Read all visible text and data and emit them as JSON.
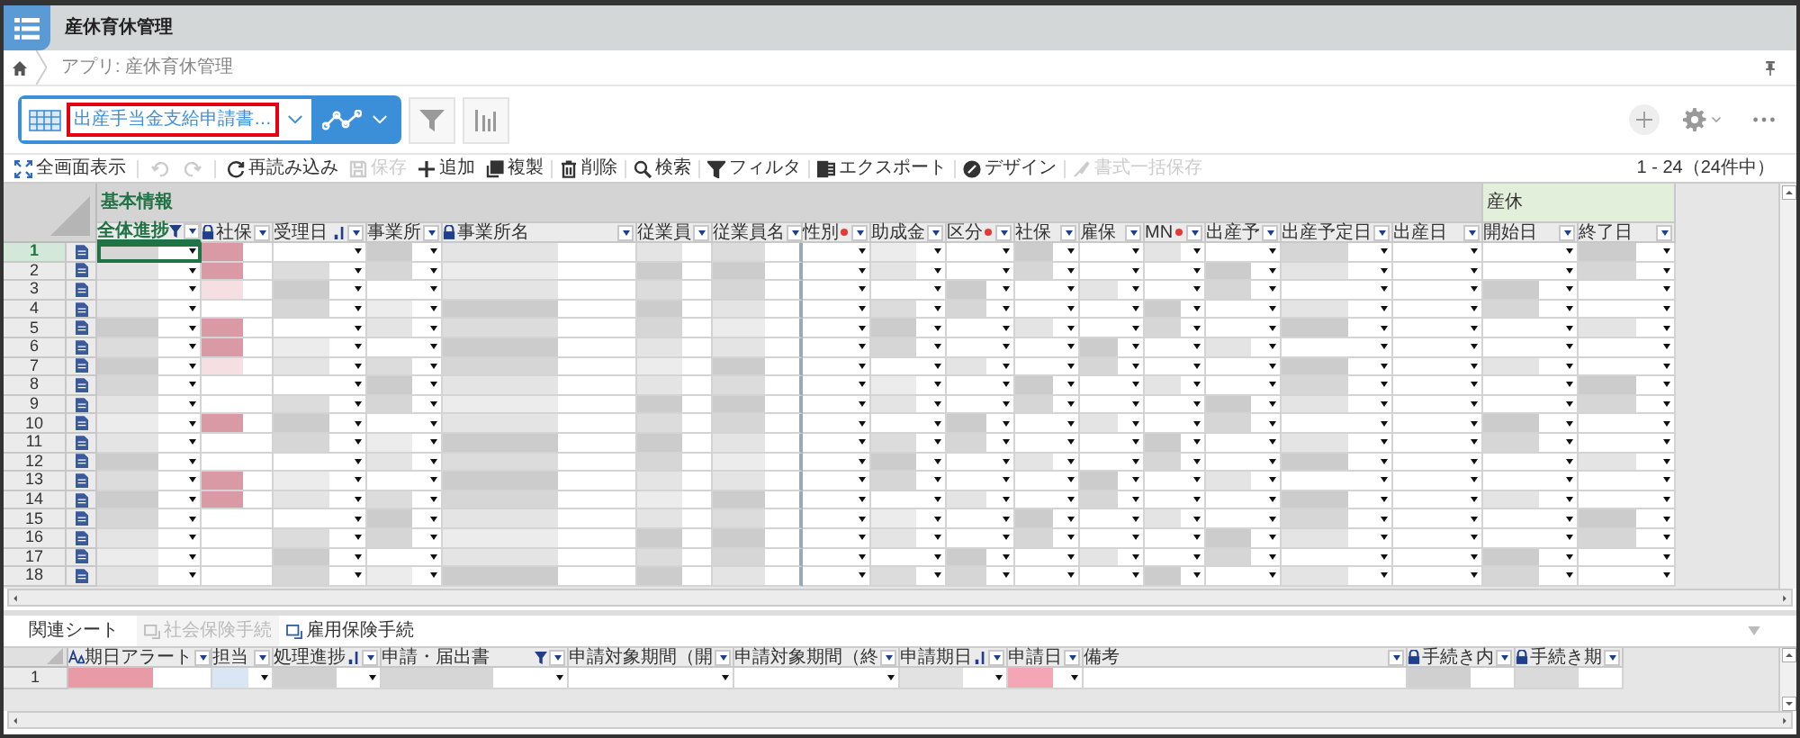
{
  "app": {
    "title": "産休育休管理"
  },
  "breadcrumb": {
    "text": "アプリ: 産休育休管理"
  },
  "view_selector": {
    "view_name": "出産手当金支給申請書…"
  },
  "history_buttons": [
    {
      "disabled": true
    },
    {
      "disabled": true
    }
  ],
  "toolbar": [
    {
      "label": "全画面表示",
      "disabled": false
    },
    {
      "label": "再読み込み",
      "disabled": false
    },
    {
      "label": "保存",
      "disabled": true
    },
    {
      "label": "追加",
      "disabled": false
    },
    {
      "label": "複製",
      "disabled": false
    },
    {
      "label": "削除",
      "disabled": false
    },
    {
      "label": "検索",
      "disabled": false
    },
    {
      "label": "フィルタ",
      "disabled": false
    },
    {
      "label": "エクスポート",
      "disabled": false
    },
    {
      "label": "デザイン",
      "disabled": false
    },
    {
      "label": "書式一括保存",
      "disabled": true
    }
  ],
  "record_count": "1 - 24（24件中）",
  "grid": {
    "groups": [
      {
        "label": "基本情報",
        "color": "#d4d4d4",
        "selected": true,
        "columns": [
          {
            "label": "全体進捗",
            "kind": "filter",
            "locked": false,
            "required": false,
            "dropdown": true,
            "selected": true
          },
          {
            "label": "社保",
            "kind": "plain",
            "locked": true,
            "required": false,
            "dropdown": false,
            "selected": false
          },
          {
            "label": "受理日",
            "kind": "sort",
            "locked": false,
            "required": false,
            "dropdown": true,
            "selected": false
          },
          {
            "label": "事業所",
            "kind": "plain",
            "locked": false,
            "required": false,
            "dropdown": true,
            "selected": false
          },
          {
            "label": "事業所名",
            "kind": "plain",
            "locked": true,
            "required": false,
            "dropdown": false,
            "selected": false
          },
          {
            "label": "従業員",
            "kind": "plain",
            "locked": false,
            "required": false,
            "dropdown": false,
            "selected": false
          },
          {
            "label": "従業員名",
            "kind": "plain",
            "locked": false,
            "required": false,
            "dropdown": false,
            "selected": false
          },
          {
            "label": "性別",
            "kind": "plain",
            "locked": false,
            "required": true,
            "dropdown": true,
            "selected": false
          },
          {
            "label": "助成金",
            "kind": "plain",
            "locked": false,
            "required": false,
            "dropdown": true,
            "selected": false
          },
          {
            "label": "区分",
            "kind": "plain",
            "locked": false,
            "required": true,
            "dropdown": true,
            "selected": false
          },
          {
            "label": "社保",
            "kind": "plain",
            "locked": false,
            "required": false,
            "dropdown": true,
            "selected": false
          },
          {
            "label": "雇保",
            "kind": "plain",
            "locked": false,
            "required": false,
            "dropdown": true,
            "selected": false
          },
          {
            "label": "MN",
            "kind": "plain",
            "locked": false,
            "required": true,
            "dropdown": true,
            "selected": false
          },
          {
            "label": "出産予",
            "kind": "plain",
            "locked": false,
            "required": false,
            "dropdown": true,
            "selected": false
          },
          {
            "label": "出産予定日",
            "kind": "plain",
            "locked": false,
            "required": false,
            "dropdown": true,
            "selected": false
          },
          {
            "label": "出産日",
            "kind": "plain",
            "locked": false,
            "required": false,
            "dropdown": true,
            "selected": false
          }
        ]
      },
      {
        "label": "産休",
        "color": "#e2efda",
        "selected": false,
        "columns": [
          {
            "label": "開始日",
            "kind": "plain",
            "locked": false,
            "required": false,
            "dropdown": true,
            "selected": false
          },
          {
            "label": "終了日",
            "kind": "plain",
            "locked": false,
            "required": false,
            "dropdown": true,
            "selected": false
          }
        ]
      }
    ],
    "rows": [
      {
        "number": "1",
        "selected": true
      },
      {
        "number": "2",
        "selected": false
      },
      {
        "number": "3",
        "selected": false
      },
      {
        "number": "4",
        "selected": false
      },
      {
        "number": "5",
        "selected": false
      },
      {
        "number": "6",
        "selected": false
      },
      {
        "number": "7",
        "selected": false
      },
      {
        "number": "8",
        "selected": false
      },
      {
        "number": "9",
        "selected": false
      },
      {
        "number": "10",
        "selected": false
      },
      {
        "number": "11",
        "selected": false
      },
      {
        "number": "12",
        "selected": false
      },
      {
        "number": "13",
        "selected": false
      },
      {
        "number": "14",
        "selected": false
      },
      {
        "number": "15",
        "selected": false
      },
      {
        "number": "16",
        "selected": false
      },
      {
        "number": "17",
        "selected": false
      },
      {
        "number": "18",
        "selected": false
      }
    ]
  },
  "related": {
    "title": "関連シート",
    "tabs": [
      {
        "label": "社会保険手続",
        "selected": false
      },
      {
        "label": "雇用保険手続",
        "selected": true
      }
    ],
    "columns": [
      {
        "label": "期日アラート",
        "kind": "alert",
        "locked": false,
        "required": false,
        "dropdown": false
      },
      {
        "label": "担当",
        "kind": "plain",
        "locked": false,
        "required": false,
        "dropdown": true
      },
      {
        "label": "処理進捗",
        "kind": "sort",
        "locked": false,
        "required": false,
        "dropdown": true
      },
      {
        "label": "申請・届出書",
        "kind": "filter",
        "locked": false,
        "required": false,
        "dropdown": true
      },
      {
        "label": "申請対象期間（開",
        "kind": "plain",
        "locked": false,
        "required": false,
        "dropdown": true
      },
      {
        "label": "申請対象期間（終",
        "kind": "plain",
        "locked": false,
        "required": false,
        "dropdown": true
      },
      {
        "label": "申請期日",
        "kind": "sort",
        "locked": false,
        "required": false,
        "dropdown": true
      },
      {
        "label": "申請日",
        "kind": "plain",
        "locked": false,
        "required": false,
        "dropdown": true
      },
      {
        "label": "備考",
        "kind": "plain",
        "locked": false,
        "required": false,
        "dropdown": false
      },
      {
        "label": "手続き内",
        "kind": "plain",
        "locked": true,
        "required": false,
        "dropdown": false
      },
      {
        "label": "手続き期",
        "kind": "plain",
        "locked": true,
        "required": false,
        "dropdown": false
      }
    ],
    "rows": [
      {
        "number": "1"
      }
    ]
  }
}
